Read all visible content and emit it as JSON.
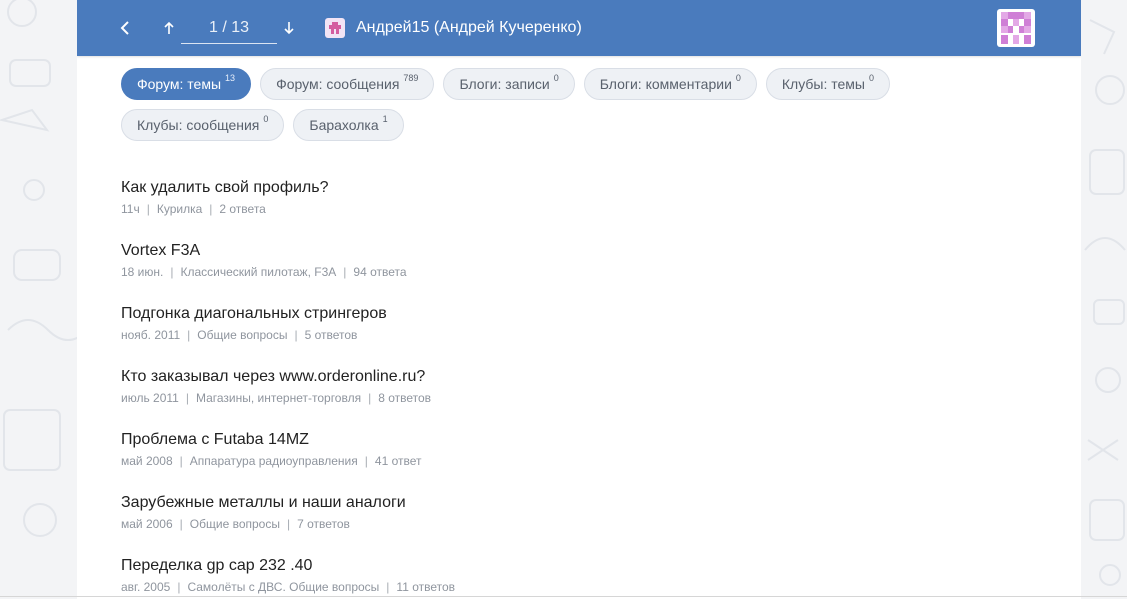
{
  "header": {
    "back_icon": "chevron-left-icon",
    "prev_icon": "arrow-up-icon",
    "next_icon": "arrow-down-icon",
    "page_indicator": "1 / 13",
    "user_icon": "user-badge-icon",
    "user_name": "Андрей15 (Андрей Кучеренко)",
    "avatar_icon": "identicon-avatar",
    "bar_color": "#4a7bbd"
  },
  "tabs": [
    {
      "label": "Форум: темы",
      "count": "13",
      "active": true
    },
    {
      "label": "Форум: сообщения",
      "count": "789",
      "active": false
    },
    {
      "label": "Блоги: записи",
      "count": "0",
      "active": false
    },
    {
      "label": "Блоги: комментарии",
      "count": "0",
      "active": false
    },
    {
      "label": "Клубы: темы",
      "count": "0",
      "active": false
    },
    {
      "label": "Клубы: сообщения",
      "count": "0",
      "active": false
    },
    {
      "label": "Барахолка",
      "count": "1",
      "active": false
    }
  ],
  "topics": [
    {
      "title": "Как удалить свой профиль?",
      "date": "11ч",
      "section": "Курилка",
      "replies": "2 ответа"
    },
    {
      "title": "Vortex F3A",
      "date": "18 июн.",
      "section": "Классический пилотаж, F3A",
      "replies": "94 ответа"
    },
    {
      "title": "Подгонка диагональных стрингеров",
      "date": "нояб. 2011",
      "section": "Общие вопросы",
      "replies": "5 ответов"
    },
    {
      "title": "Кто заказывал через www.orderonline.ru?",
      "date": "июль 2011",
      "section": "Магазины, интернет-торговля",
      "replies": "8 ответов"
    },
    {
      "title": "Проблема с Futaba 14MZ",
      "date": "май 2008",
      "section": "Аппаратура радиоуправления",
      "replies": "41 ответ"
    },
    {
      "title": "Зарубежные металлы и наши аналоги",
      "date": "май 2006",
      "section": "Общие вопросы",
      "replies": "7 ответов"
    },
    {
      "title": "Переделка gp cap 232 .40",
      "date": "авг. 2005",
      "section": "Самолёты с ДВС. Общие вопросы",
      "replies": "11 ответов"
    }
  ]
}
